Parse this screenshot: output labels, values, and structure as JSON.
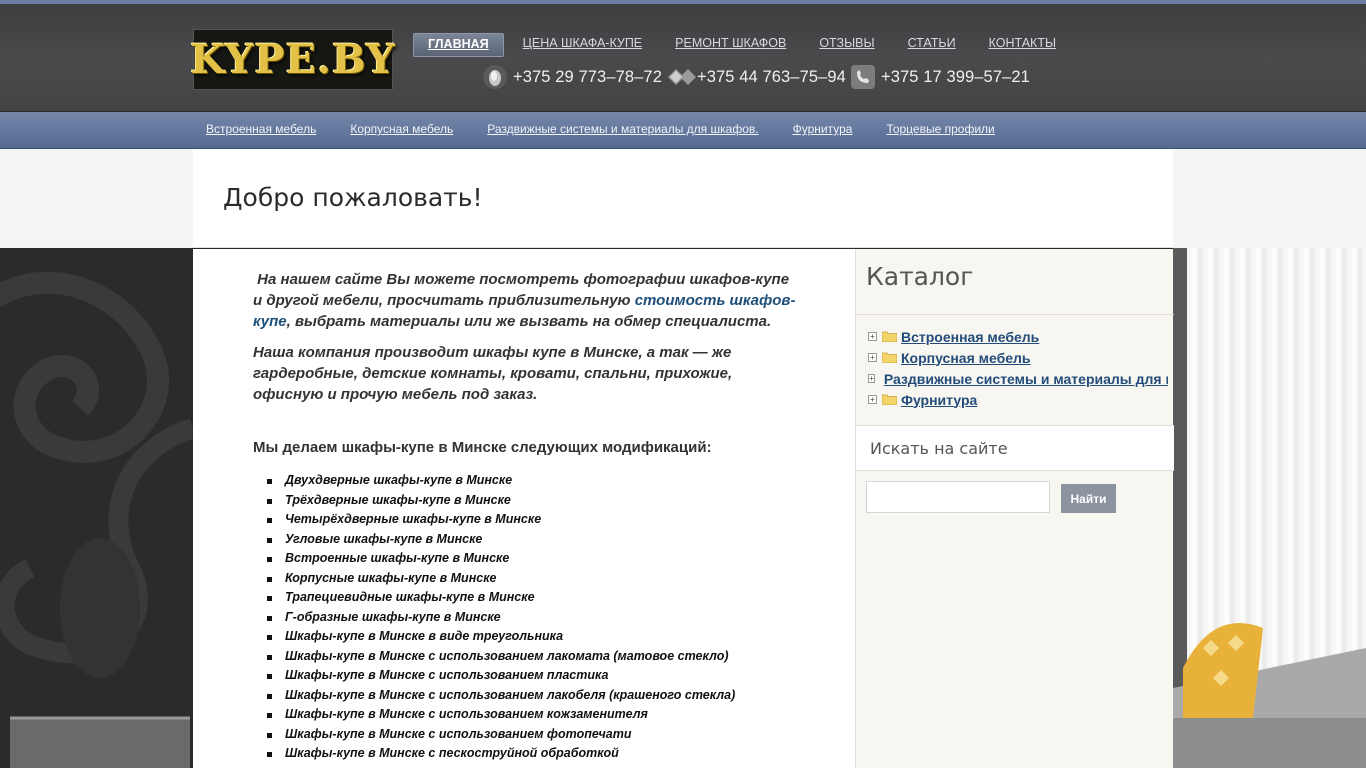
{
  "header": {
    "logo_text": "KYPE.BY",
    "nav": [
      {
        "label": "Главная",
        "active": true
      },
      {
        "label": "Цена шкафа-купе",
        "active": false
      },
      {
        "label": "Ремонт шкафов",
        "active": false
      },
      {
        "label": "Отзывы",
        "active": false
      },
      {
        "label": "Статьи",
        "active": false
      },
      {
        "label": "Контакты",
        "active": false
      }
    ],
    "phones": [
      {
        "icon": "velcom-icon",
        "number": "+375 29 773–78–72"
      },
      {
        "icon": "mts-icon",
        "number": "+375 44 763–75–94"
      },
      {
        "icon": "landline-phone-icon",
        "number": "+375 17 399–57–21"
      }
    ]
  },
  "subnav": [
    "Встроенная мебель",
    "Корпусная мебель",
    "Раздвижные системы и материалы для шкафов.",
    "Фурнитура",
    "Торцевые профили"
  ],
  "welcome_title": "Добро пожаловать!",
  "intro": {
    "p1_start": "На нашем сайте Вы можете посмотреть фотографии шкафов-купе и другой мебели, просчитать приблизительную ",
    "p1_link": "стоимость шкафов-купе",
    "p1_end": ", выбрать материалы или же вызвать на обмер специалиста.",
    "p2": "Наша компания производит шкафы купе в Минске, а  так — же гардеробные, детские комнаты, кровати, спальни, прихожие, офисную и прочую мебель под заказ."
  },
  "mods_title": "Мы делаем шкафы-купе в Минске следующих модификаций:",
  "mods": [
    "Двухдверные шкафы-купе в Минске",
    "Трёхдверные шкафы-купе в Минске",
    "Четырёхдверные шкафы-купе в Минске",
    "Угловые шкафы-купе в Минске",
    "Встроенные шкафы-купе в Минске",
    "Корпусные  шкафы-купе в Минске",
    "Трапециевидные шкафы-купе в Минске",
    "Г-образные шкафы-купе в Минске",
    "Шкафы-купе в Минске в виде треугольника",
    "Шкафы-купе в Минске с использованием лакомата (матовое стекло)",
    "Шкафы-купе в Минске с использованием пластика",
    "Шкафы-купе в Минске с использованием лакобеля (крашеного стекла)",
    "Шкафы-купе в Минске с использованием кожзаменителя",
    "Шкафы-купе в Минске с использованием фотопечати",
    "Шкафы-купе в Минске с пескоструйной обработкой"
  ],
  "sidebar": {
    "catalog_title": "Каталог",
    "catalog": [
      "Встроенная мебель",
      "Корпусная мебель",
      "Раздвижные системы и материалы для шкафов.",
      "Фурнитура"
    ],
    "search_title": "Искать на сайте",
    "search_value": "",
    "search_button": "Найти"
  },
  "colors": {
    "header_bg": "#444446",
    "subnav_bg": "#6479a0",
    "link": "#234c7a",
    "logo_gold": "#e3c046"
  }
}
